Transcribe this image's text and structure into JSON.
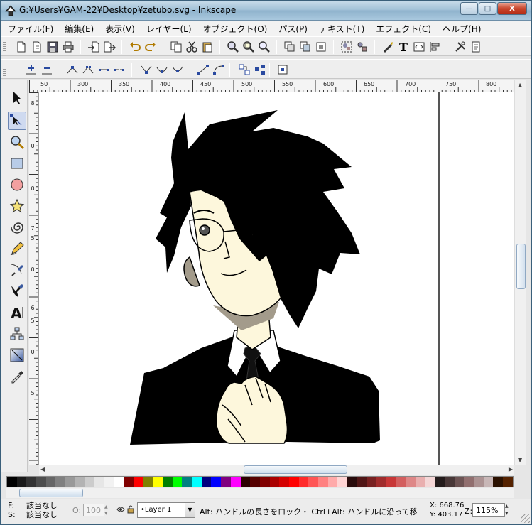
{
  "window": {
    "title": "G:¥Users¥GAM-22¥Desktop¥zetubo.svg - Inkscape",
    "minimize": "—",
    "maximize": "□",
    "close": "X"
  },
  "menu": [
    "ファイル(F)",
    "編集(E)",
    "表示(V)",
    "レイヤー(L)",
    "オブジェクト(O)",
    "パス(P)",
    "テキスト(T)",
    "エフェクト(C)",
    "ヘルプ(H)"
  ],
  "ruler": {
    "top": [
      "50",
      "300",
      "350",
      "400",
      "450",
      "500",
      "550",
      "600",
      "650",
      "700",
      "750",
      "800"
    ],
    "left": [
      "8",
      "0",
      "0",
      "7",
      "5",
      "0",
      "6",
      "5",
      "0",
      "5"
    ]
  },
  "palette": {
    "colors": [
      "#000000",
      "#1a1a1a",
      "#333333",
      "#4d4d4d",
      "#666666",
      "#808080",
      "#999999",
      "#b3b3b3",
      "#cccccc",
      "#e6e6e6",
      "#f2f2f2",
      "#ffffff",
      "#800000",
      "#ff0000",
      "#808000",
      "#ffff00",
      "#008000",
      "#00ff00",
      "#008080",
      "#00ffff",
      "#000080",
      "#0000ff",
      "#800080",
      "#ff00ff",
      "#2b0000",
      "#550000",
      "#800000",
      "#aa0000",
      "#d40000",
      "#ff0000",
      "#ff2a2a",
      "#ff5555",
      "#ff8080",
      "#ffaaaa",
      "#ffd5d5",
      "#280b0b",
      "#501616",
      "#782121",
      "#a02c2c",
      "#c83737",
      "#d35f5f",
      "#de8787",
      "#e9afaf",
      "#f4d7d7",
      "#241c1c",
      "#483737",
      "#6c5353",
      "#916f6f",
      "#ac9393",
      "#c8b7b7",
      "#2b1100",
      "#552200"
    ]
  },
  "status": {
    "fill_label": "F:",
    "stroke_label": "S:",
    "fill_value": "該当なし",
    "stroke_value": "該当なし",
    "opacity_label": "O:",
    "opacity_value": "100",
    "layer": "•Layer 1",
    "message": "Alt: ハンドルの長さをロック・ Ctrl+Alt: ハンドルに沿って移",
    "x": "X: 668.76",
    "y": "Y: 403.17",
    "zoom_label": "Z:",
    "zoom": "115%"
  },
  "colors": {
    "skin": "#fdf7dc",
    "shadow": "#a39b8b",
    "hair": "#000000",
    "accent": "#5b79a8"
  }
}
